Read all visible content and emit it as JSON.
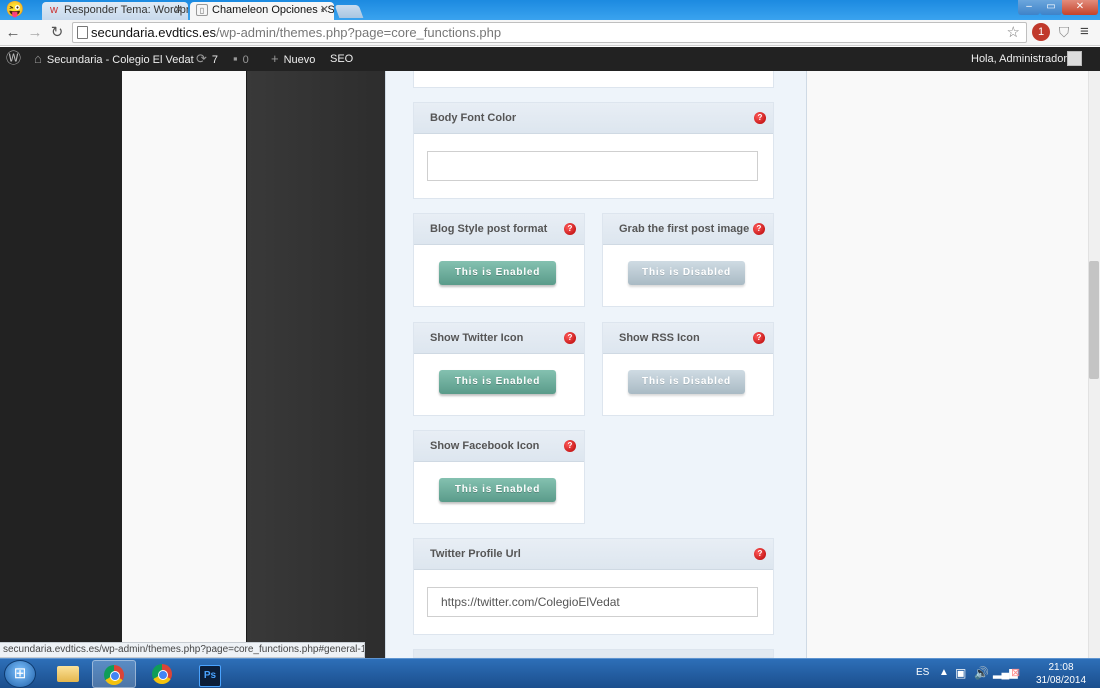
{
  "browser": {
    "tabs": [
      {
        "label": "Responder Tema: Wordpr",
        "active": false
      },
      {
        "label": "Chameleon Opciones ‹ Se",
        "active": true
      }
    ],
    "url_host": "secundaria.evdtics.es",
    "url_path": "/wp-admin/themes.php?page=core_functions.php",
    "extension_badge": "1",
    "status_url": "secundaria.evdtics.es/wp-admin/themes.php?page=core_functions.php#general-1"
  },
  "adminbar": {
    "site_name": "Secundaria - Colegio El Vedat",
    "updates_count": "7",
    "comments_count": "0",
    "new_label": "Nuevo",
    "seo_label": "SEO",
    "greeting": "Hola, Administrador"
  },
  "options": {
    "body_font_color": {
      "label": "Body Font Color",
      "value": ""
    },
    "blog_style": {
      "label": "Blog Style post format",
      "state": "This is Enabled"
    },
    "grab_image": {
      "label": "Grab the first post image",
      "state": "This is Disabled"
    },
    "twitter_icon": {
      "label": "Show Twitter Icon",
      "state": "This is Enabled"
    },
    "rss_icon": {
      "label": "Show RSS Icon",
      "state": "This is Disabled"
    },
    "facebook_icon": {
      "label": "Show Facebook Icon",
      "state": "This is Enabled"
    },
    "twitter_url": {
      "label": "Twitter Profile Url",
      "value": "https://twitter.com/ColegioElVedat"
    }
  },
  "help_glyph": "?",
  "taskbar": {
    "language": "ES",
    "time": "21:08",
    "date": "31/08/2014",
    "apps": [
      "windows-explorer",
      "google-chrome",
      "google-chrome",
      "adobe-photoshop"
    ],
    "ps_label": "Ps"
  },
  "colors": {
    "enabled": "#6aa999",
    "disabled": "#b7c7d0",
    "help": "#cc0000",
    "adminbar": "#222222"
  }
}
